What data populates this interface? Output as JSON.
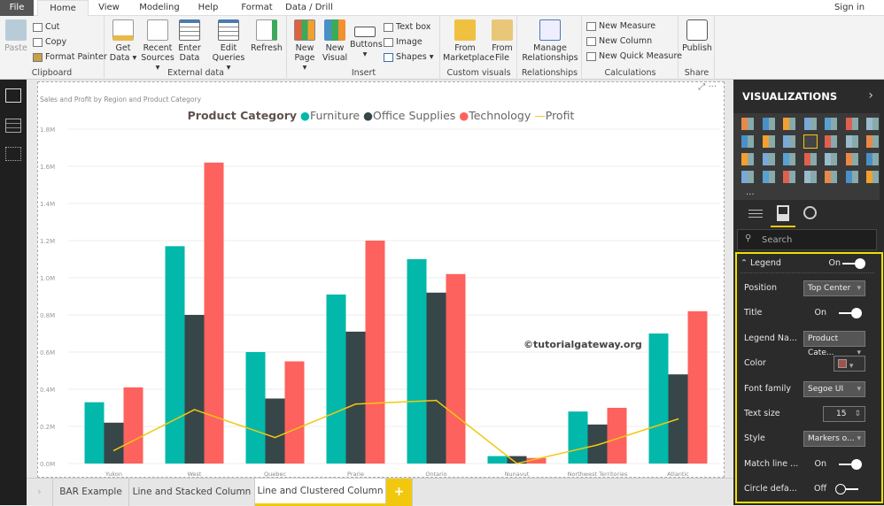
{
  "ribbon_tabs": [
    "File",
    "Home",
    "View",
    "Modeling",
    "Help",
    "Format",
    "Data / Drill"
  ],
  "sign_in": "Sign in",
  "groups": {
    "clipboard": {
      "label": "Clipboard",
      "paste": "Paste",
      "cut": "Cut",
      "copy": "Copy",
      "format_painter": "Format Painter"
    },
    "external_data": {
      "label": "External data",
      "get_data": "Get Data ▾",
      "recent_sources": "Recent Sources ▾",
      "enter_data": "Enter Data",
      "edit_queries": "Edit Queries ▾",
      "refresh": "Refresh"
    },
    "insert": {
      "label": "Insert",
      "new_page": "New Page ▾",
      "new_visual": "New Visual",
      "buttons": "Buttons ▾",
      "text_box": "Text box",
      "image": "Image",
      "shapes": "Shapes ▾"
    },
    "custom_visuals": {
      "label": "Custom visuals",
      "from_marketplace": "From Marketplace",
      "from_file": "From File"
    },
    "relationships": {
      "label": "Relationships",
      "manage": "Manage Relationships"
    },
    "calculations": {
      "label": "Calculations",
      "new_measure": "New Measure",
      "new_column": "New Column",
      "new_quick_measure": "New Quick Measure"
    },
    "share": {
      "label": "Share",
      "publish": "Publish"
    }
  },
  "page_tabs": [
    "BAR Example",
    "Line and Stacked Column",
    "Line and Clustered Column"
  ],
  "active_page": "Line and Clustered Column",
  "add_page": "+",
  "watermark": "©tutorialgateway.org",
  "panel": {
    "title": "VISUALIZATIONS",
    "more": "...",
    "search_placeholder": "Search",
    "legend": {
      "label": "Legend",
      "state": "On"
    },
    "rows": [
      {
        "label": "Position",
        "value": "Top Center"
      },
      {
        "label": "Title",
        "value": "On"
      },
      {
        "label": "Legend Na...",
        "value": "Product Cate..."
      },
      {
        "label": "Color",
        "value": "#a0524a"
      },
      {
        "label": "Font family",
        "value": "Segoe UI"
      },
      {
        "label": "Text size",
        "value": "15"
      },
      {
        "label": "Style",
        "value": "Markers o..."
      },
      {
        "label": "Match line ...",
        "value": "On"
      },
      {
        "label": "Circle defa...",
        "value": "Off"
      }
    ]
  },
  "chart_data": {
    "type": "bar",
    "title": "Sales and Profit by Region and Product Category",
    "legend_title": "Product Category",
    "legend_position": "top-center",
    "categories": [
      "Yukon",
      "West",
      "Quebec",
      "Prarie",
      "Ontario",
      "Nunavut",
      "Northwest Territories",
      "Atlantic"
    ],
    "series": [
      {
        "name": "Furniture",
        "color": "#01b8aa",
        "values": [
          0.33,
          1.17,
          0.6,
          0.91,
          1.1,
          0.04,
          0.28,
          0.7
        ]
      },
      {
        "name": "Office Supplies",
        "color": "#374649",
        "values": [
          0.22,
          0.8,
          0.35,
          0.71,
          0.92,
          0.04,
          0.21,
          0.48
        ]
      },
      {
        "name": "Technology",
        "color": "#fd625e",
        "values": [
          0.41,
          1.62,
          0.55,
          1.2,
          1.02,
          0.03,
          0.3,
          0.82
        ]
      }
    ],
    "line_series": {
      "name": "Profit",
      "color": "#f2c80f",
      "type": "line",
      "values": [
        0.07,
        0.29,
        0.14,
        0.32,
        0.34,
        0.0,
        0.1,
        0.24
      ]
    },
    "y_unit": "M",
    "ylim": [
      0,
      1.8
    ],
    "y_ticks": [
      "0.0M",
      "0.2M",
      "0.4M",
      "0.6M",
      "0.8M",
      "1.0M",
      "1.2M",
      "1.4M",
      "1.6M",
      "1.8M"
    ],
    "grid": true
  }
}
